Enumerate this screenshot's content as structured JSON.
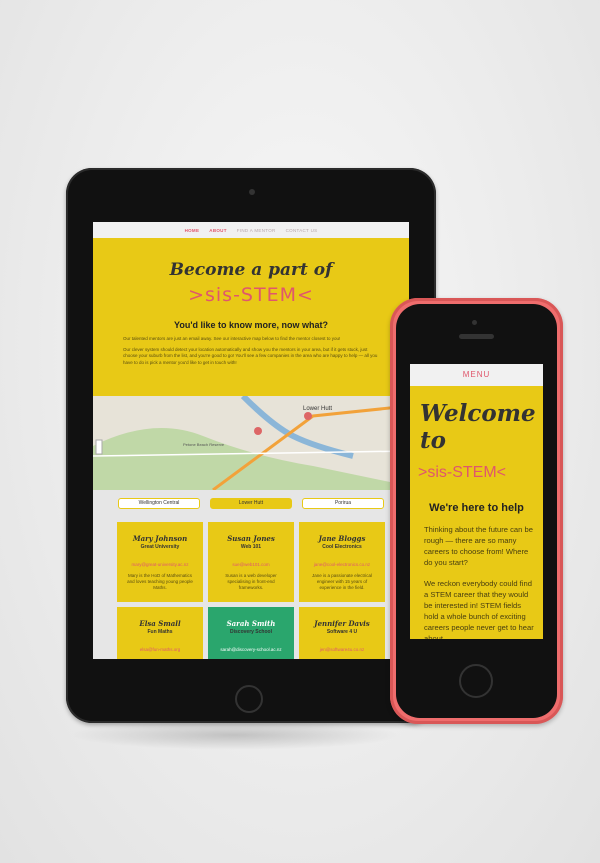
{
  "tablet": {
    "nav": [
      "HOME",
      "ABOUT",
      "FIND A MENTOR",
      "CONTACT US"
    ],
    "hero": {
      "title": "Become a part of",
      "brand": ">sis-STEM<",
      "subtitle": "You'd like to know more, now what?",
      "para1": "Our talented mentors are just an email away. See our interactive map below to find the mentor closest to you!",
      "para2": "Our clever system should detect your location automatically and show you the mentors in your area, but if it gets stuck, just choose your suburb from the list, and you're good to go! You'll see a few companies in the area who are happy to help — all you have to do is pick a mentor you'd like to get in touch with!"
    },
    "map_labels": [
      "Lower Hutt",
      "Petone Beach Reserve"
    ],
    "tabs": [
      "Wellington Central",
      "Lower Hutt",
      "Porirua"
    ],
    "cards": [
      {
        "name": "Mary Johnson",
        "org": "Great University",
        "email": "mary@great-university.ac.nz",
        "bio": "Mary is the HoD of Mathematics and loves teaching young people Maths."
      },
      {
        "name": "Susan Jones",
        "org": "Web 101",
        "email": "sue@web101.com",
        "bio": "Susan is a web developer specialising in front-end frameworks."
      },
      {
        "name": "Jane Bloggs",
        "org": "Cool Electronics",
        "email": "jane@cool-electronics.co.nz",
        "bio": "Jane is a passionate electrical engineer with 15 years of experience in the field."
      },
      {
        "name": "Elsa Small",
        "org": "Fun Maths",
        "email": "elsa@fun-maths.org",
        "bio": ""
      },
      {
        "name": "Sarah Smith",
        "org": "Discovery School",
        "email": "sarah@discovery-school.ac.nz",
        "bio": ""
      },
      {
        "name": "Jennifer Davis",
        "org": "Software 4 U",
        "email": "jen@software4u.co.nz",
        "bio": ""
      }
    ]
  },
  "phone": {
    "nav": "MENU",
    "welcome": "Welcome to",
    "brand": ">sis-STEM<",
    "heading": "We're here to help",
    "para1": "Thinking about the future can be rough — there are so many careers to choose from! Where do you start?",
    "para2": "We reckon everybody could find a STEM career that they would be interested in! STEM fields hold a whole bunch of exciting careers people never get to hear about."
  },
  "colors": {
    "accent": "#e8c916",
    "pink": "#e0576c",
    "green": "#2aa66d"
  }
}
